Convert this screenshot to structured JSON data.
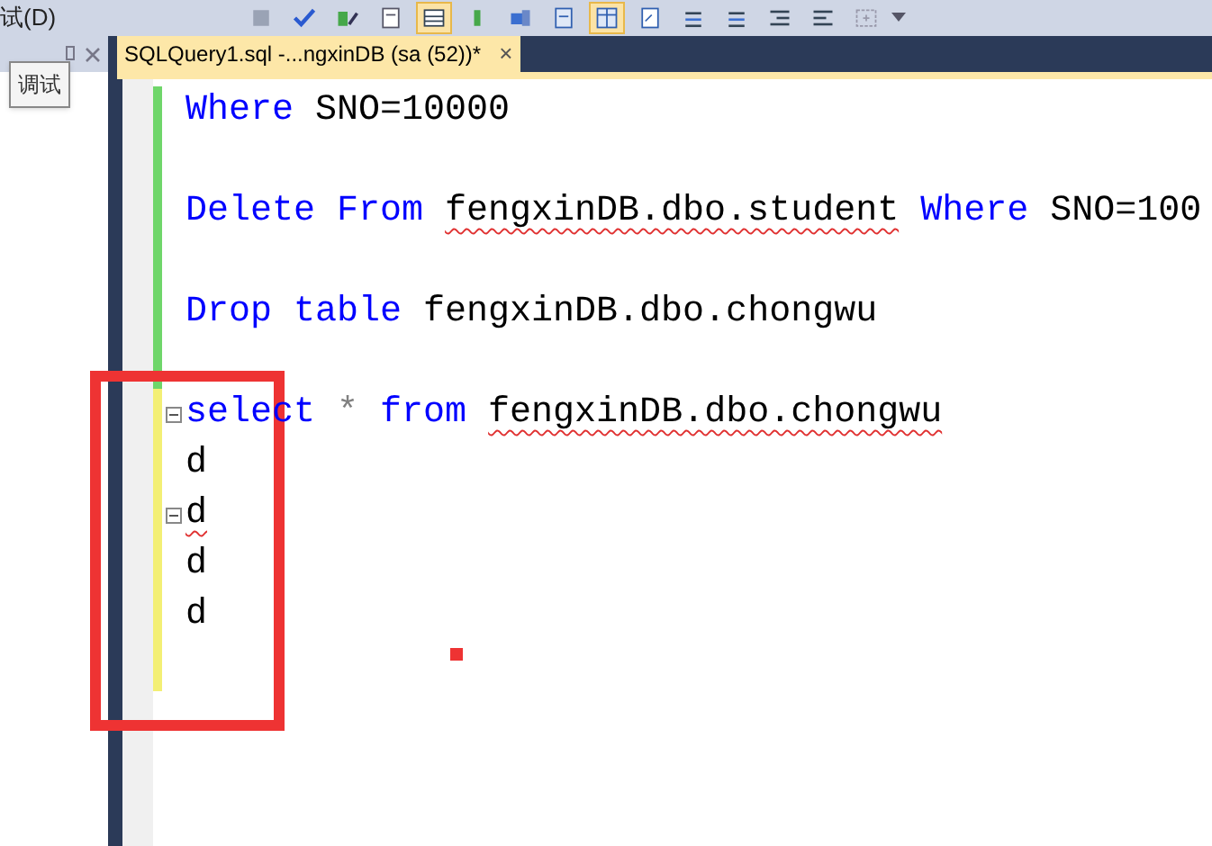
{
  "toolbar": {
    "menu_label": "试(D)",
    "buttons": [
      {
        "selected": false
      },
      {
        "selected": true
      },
      {
        "selected": false
      },
      {
        "selected": false
      },
      {
        "selected": false
      },
      {
        "selected": true
      },
      {
        "selected": false
      }
    ]
  },
  "side_panel": {
    "tooltip": "调试"
  },
  "tab": {
    "title": "SQLQuery1.sql -...ngxinDB (sa (52))*",
    "close": "×",
    "selected": true
  },
  "editor": {
    "lines": [
      {
        "saved": true,
        "tokens": [
          {
            "text": "Where",
            "kind": "keyword"
          },
          {
            "text": " SNO=10000",
            "kind": "ident"
          }
        ]
      },
      {
        "saved": true
      },
      {
        "saved": true,
        "tokens": [
          {
            "text": "Delete From ",
            "kind": "keyword"
          },
          {
            "text": "fengxinDB.dbo.student",
            "kind": "ident",
            "error": true
          },
          {
            "text": " Where",
            "kind": "keyword"
          },
          {
            "text": " SNO=100",
            "kind": "ident"
          }
        ]
      },
      {
        "saved": true
      },
      {
        "saved": true,
        "tokens": [
          {
            "text": "Drop table",
            "kind": "keyword"
          },
          {
            "text": " fengxinDB.dbo.chongwu",
            "kind": "ident"
          }
        ]
      },
      {
        "saved": true
      },
      {
        "saved": false,
        "fold": true,
        "tokens": [
          {
            "text": "select",
            "kind": "keyword"
          },
          {
            "text": " * ",
            "kind": "operator"
          },
          {
            "text": "from ",
            "kind": "keyword"
          },
          {
            "text": "fengxinDB.dbo.chongwu",
            "kind": "ident",
            "error": true
          }
        ]
      },
      {
        "saved": false,
        "tokens": [
          {
            "text": "d",
            "kind": "ident"
          }
        ]
      },
      {
        "saved": false,
        "fold": true,
        "tokens": [
          {
            "text": "d",
            "kind": "ident",
            "error": true
          }
        ]
      },
      {
        "saved": false,
        "tokens": [
          {
            "text": "d",
            "kind": "ident"
          }
        ]
      },
      {
        "saved": false,
        "tokens": [
          {
            "text": "d",
            "kind": "ident"
          }
        ]
      },
      {
        "saved": false
      }
    ]
  }
}
